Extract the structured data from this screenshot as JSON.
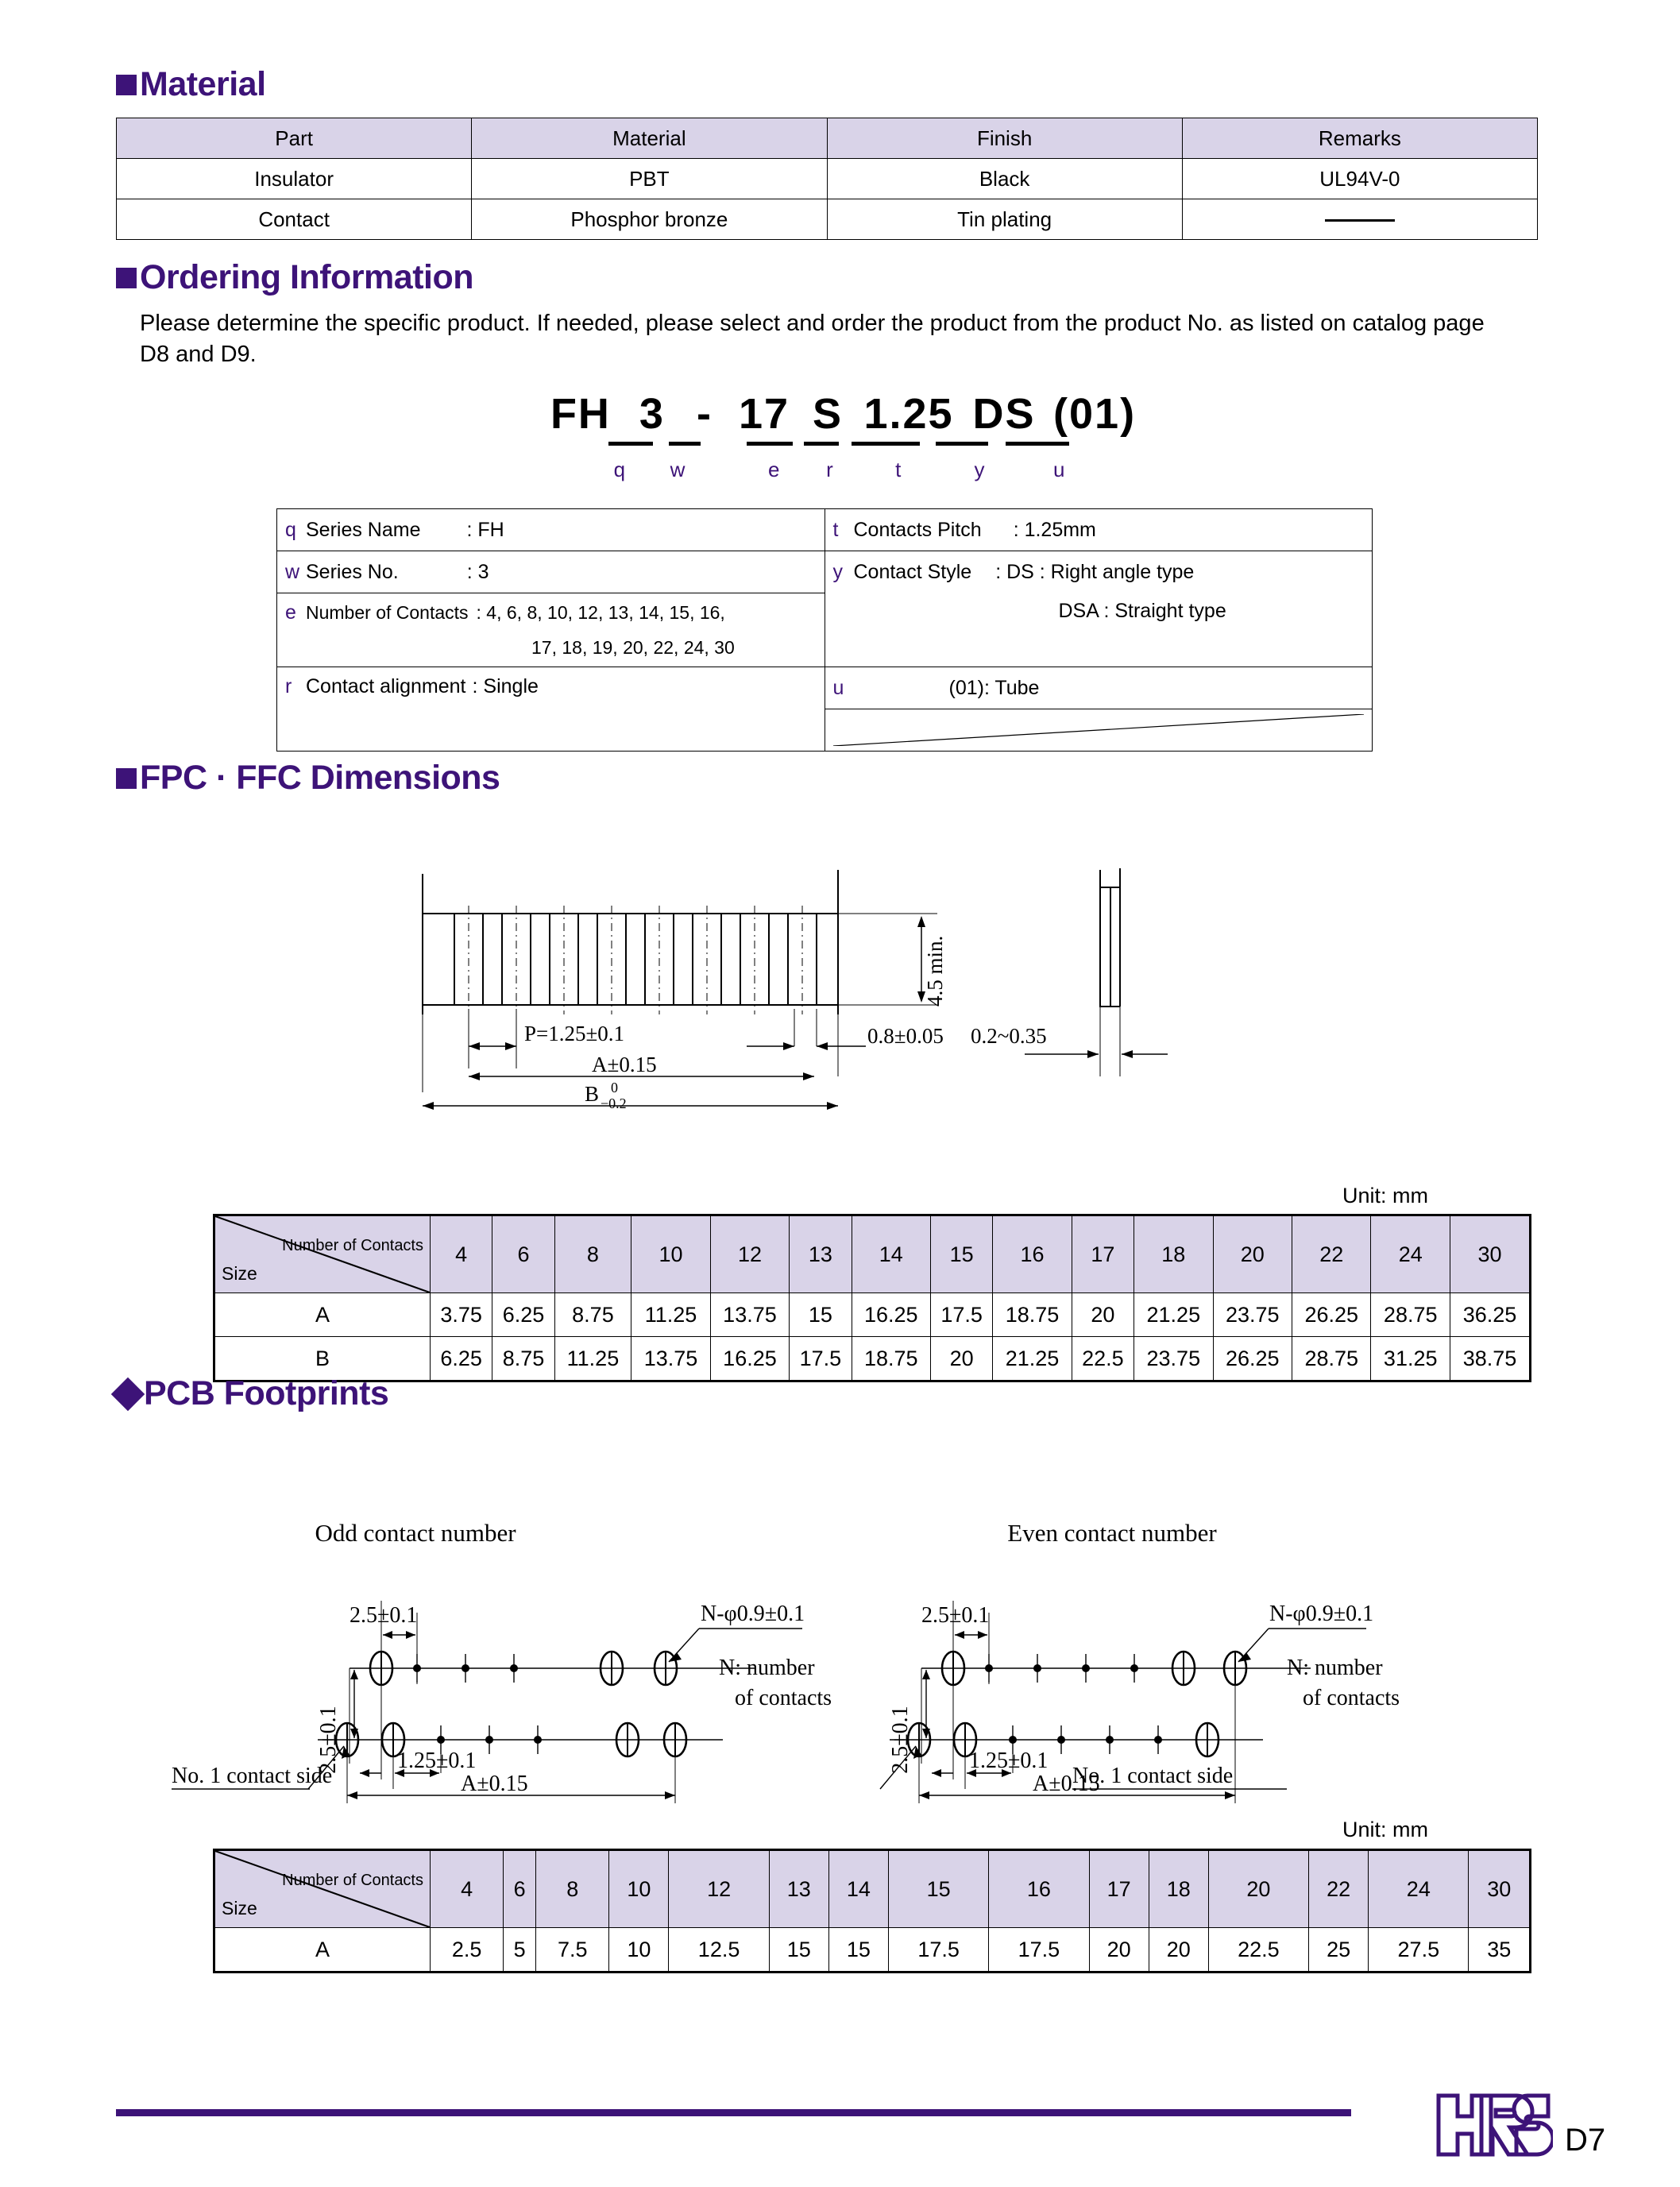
{
  "material": {
    "heading": "Material",
    "columns": [
      "Part",
      "Material",
      "Finish",
      "Remarks"
    ],
    "rows": [
      [
        "Insulator",
        "PBT",
        "Black",
        "UL94V-0"
      ],
      [
        "Contact",
        "Phosphor bronze",
        "Tin plating",
        "—"
      ]
    ]
  },
  "ordering": {
    "heading": "Ordering Information",
    "note": "Please determine the specific product. If needed, please select and order the product from the product No. as listed on catalog page D8 and D9.",
    "part_number_tokens": [
      "FH",
      "3",
      "-",
      "17",
      "S",
      "1.25",
      "DS",
      "(01)"
    ],
    "index_letters": [
      "q",
      "w",
      "e",
      "r",
      "t",
      "y",
      "u"
    ],
    "legend_left": [
      {
        "key": "q",
        "label": "Series Name",
        "value": ": FH"
      },
      {
        "key": "w",
        "label": "Series No.",
        "value": ": 3"
      },
      {
        "key": "e",
        "label": "Number of Contacts",
        "value": ": 4, 6, 8, 10, 12, 13, 14, 15, 16,"
      },
      {
        "key": "",
        "label": "",
        "value": "17, 18, 19, 20, 22, 24, 30"
      },
      {
        "key": "r",
        "label": "Contact alignment",
        "value": ": Single"
      }
    ],
    "legend_right": [
      {
        "key": "t",
        "label": "Contacts Pitch",
        "value": ": 1.25mm"
      },
      {
        "key": "y",
        "label": "Contact Style",
        "value": ": DS : Right angle type"
      },
      {
        "key": "",
        "label": "",
        "value": "DSA : Straight type"
      },
      {
        "key": "u",
        "label": "",
        "value": "(01): Tube"
      }
    ]
  },
  "fpc": {
    "heading": "FPC · FFC Dimensions",
    "unit_label": "Unit: mm",
    "dim_pitch": "P=1.25±0.1",
    "dim_a": "A±0.15",
    "dim_b": "B",
    "dim_b_sup": "0",
    "dim_b_sub": "-0.2",
    "dim_height": "4.5 min.",
    "dim_tail": "0.8±0.05",
    "dim_thickness": "0.2~0.35"
  },
  "pcb": {
    "heading": "PCB Footprints",
    "unit_label": "Unit: mm",
    "odd_title": "Odd contact number",
    "even_title": "Even contact number",
    "dim_25": "2.5±0.1",
    "dim_25_v": "2.5±0.1",
    "dim_125": "1.25±0.1",
    "dim_a": "A±0.15",
    "hole_note": "N-φ0.9±0.1",
    "n_note_line1": "N: number",
    "n_note_line2": "of contacts",
    "contact_side": "No. 1 contact side"
  },
  "chart_data": {
    "type": "table",
    "tables": [
      {
        "title": "FPC / FFC Dimensions",
        "corner_top": "Number of Contacts",
        "corner_bottom": "Size",
        "unit": "Unit: mm",
        "categories": [
          "4",
          "6",
          "8",
          "10",
          "12",
          "13",
          "14",
          "15",
          "16",
          "17",
          "18",
          "20",
          "22",
          "24",
          "30"
        ],
        "series": [
          {
            "name": "A",
            "values": [
              "3.75",
              "6.25",
              "8.75",
              "11.25",
              "13.75",
              "15",
              "16.25",
              "17.5",
              "18.75",
              "20",
              "21.25",
              "23.75",
              "26.25",
              "28.75",
              "36.25"
            ]
          },
          {
            "name": "B",
            "values": [
              "6.25",
              "8.75",
              "11.25",
              "13.75",
              "16.25",
              "17.5",
              "18.75",
              "20",
              "21.25",
              "22.5",
              "23.75",
              "26.25",
              "28.75",
              "31.25",
              "38.75"
            ]
          }
        ]
      },
      {
        "title": "PCB Footprints",
        "corner_top": "Number of Contacts",
        "corner_bottom": "Size",
        "unit": "Unit: mm",
        "categories": [
          "4",
          "6",
          "8",
          "10",
          "12",
          "13",
          "14",
          "15",
          "16",
          "17",
          "18",
          "20",
          "22",
          "24",
          "30"
        ],
        "series": [
          {
            "name": "A",
            "values": [
              "2.5",
              "5",
              "7.5",
              "10",
              "12.5",
              "15",
              "15",
              "17.5",
              "17.5",
              "20",
              "20",
              "22.5",
              "25",
              "27.5",
              "35"
            ]
          }
        ]
      }
    ]
  },
  "footer": {
    "logo": "HRS",
    "page": "D7"
  },
  "colors": {
    "brand": "#3d1378",
    "table_header": "#d9d3e8"
  }
}
